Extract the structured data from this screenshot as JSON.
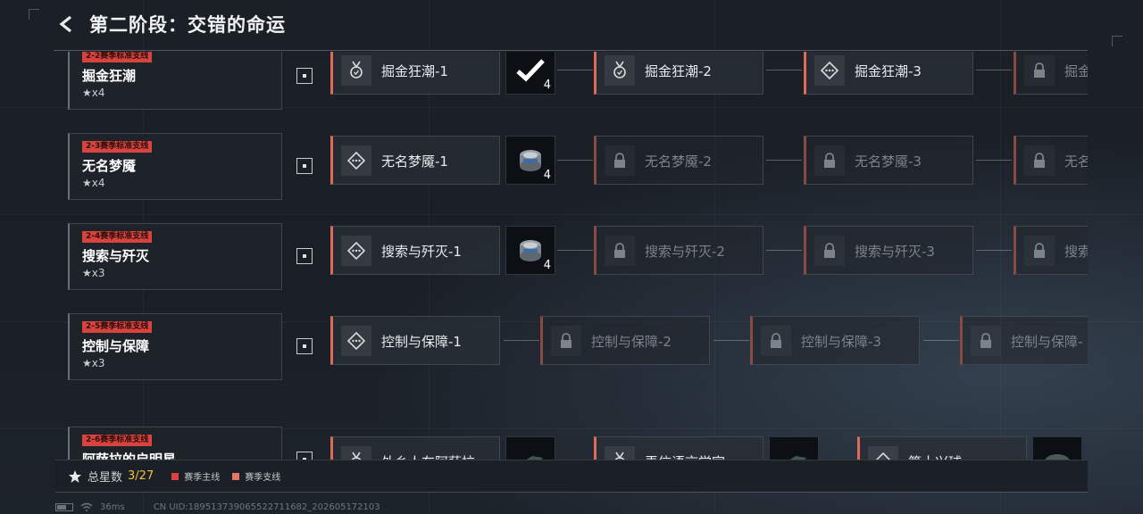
{
  "header": {
    "title": "第二阶段：交错的命运"
  },
  "rows": [
    {
      "tag": "2-2赛季标准支线",
      "name": "掘金狂潮",
      "stars": "★x4",
      "nodes": [
        {
          "label": "掘金狂潮-1",
          "state": "unlocked",
          "icon": "medal-icon"
        },
        {
          "label": "掘金狂潮-2",
          "state": "unlocked",
          "icon": "medal-icon"
        },
        {
          "label": "掘金狂潮-3",
          "state": "unlocked",
          "icon": "diamond-icon"
        },
        {
          "label": "掘金",
          "state": "locked",
          "icon": "lock-icon"
        }
      ],
      "reward": {
        "icon": "checkmark-icon",
        "qty": "4"
      }
    },
    {
      "tag": "2-3赛季标准支线",
      "name": "无名梦魇",
      "stars": "★x4",
      "nodes": [
        {
          "label": "无名梦魇-1",
          "state": "unlocked",
          "icon": "diamond-icon"
        },
        {
          "label": "无名梦魇-2",
          "state": "locked",
          "icon": "lock-icon"
        },
        {
          "label": "无名梦魇-3",
          "state": "locked",
          "icon": "lock-icon"
        },
        {
          "label": "无名",
          "state": "locked",
          "icon": "lock-icon"
        }
      ],
      "reward": {
        "icon": "canister-icon",
        "qty": "4"
      }
    },
    {
      "tag": "2-4赛季标准支线",
      "name": "搜索与歼灭",
      "stars": "★x3",
      "nodes": [
        {
          "label": "搜索与歼灭-1",
          "state": "unlocked",
          "icon": "diamond-icon"
        },
        {
          "label": "搜索与歼灭-2",
          "state": "locked",
          "icon": "lock-icon"
        },
        {
          "label": "搜索与歼灭-3",
          "state": "locked",
          "icon": "lock-icon"
        },
        {
          "label": "搜索",
          "state": "locked",
          "icon": "lock-icon"
        }
      ],
      "reward": {
        "icon": "canister-icon",
        "qty": "4"
      }
    },
    {
      "tag": "2-5赛季标准支线",
      "name": "控制与保障",
      "stars": "★x3",
      "nodes": [
        {
          "label": "控制与保障-1",
          "state": "unlocked",
          "icon": "diamond-icon"
        },
        {
          "label": "控制与保障-2",
          "state": "locked",
          "icon": "lock-icon"
        },
        {
          "label": "控制与保障-3",
          "state": "locked",
          "icon": "lock-icon"
        },
        {
          "label": "控制与保障-",
          "state": "locked",
          "icon": "lock-icon"
        }
      ]
    },
    {
      "tag": "2-6赛季标准支线",
      "name": "阿萨拉的启明星",
      "stars": "",
      "nodes": [
        {
          "label": "外乡人在阿萨拉",
          "state": "unlocked",
          "icon": "medal-icon"
        },
        {
          "label": "弄信语言学家",
          "state": "unlocked",
          "icon": "medal-icon"
        },
        {
          "label": "第十兴球",
          "state": "unlocked",
          "icon": "diamond-icon"
        }
      ]
    }
  ],
  "footer": {
    "total_label": "总星数",
    "total_value": "3/27",
    "legend": [
      {
        "label": "赛季主线",
        "color": "#d9433d"
      },
      {
        "label": "赛季支线",
        "color": "#e8736a"
      }
    ]
  },
  "status": {
    "ping": "36ms",
    "uid": "CN UID:18951373906552271168​2_202605172103"
  },
  "colors": {
    "accent_red": "#d9433d",
    "star_total": "#f0c040"
  }
}
